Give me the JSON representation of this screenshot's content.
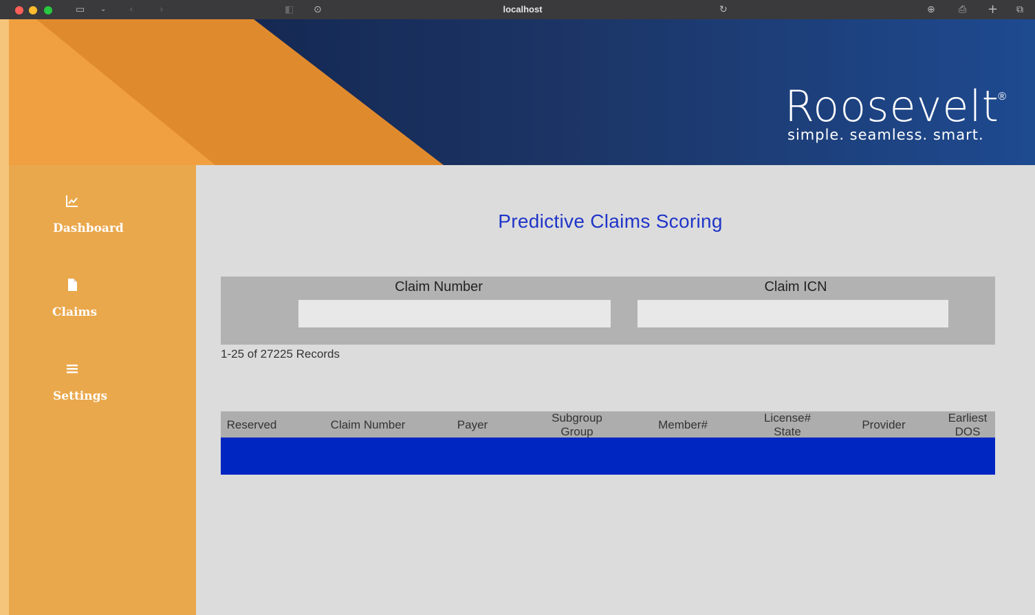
{
  "browser": {
    "url": "localhost"
  },
  "brand": {
    "name": "Roosevelt",
    "registered_mark": "®",
    "tagline": "simple. seamless. smart."
  },
  "sidebar": {
    "items": [
      {
        "label": "Dashboard",
        "icon": "chart-line-icon"
      },
      {
        "label": "Claims",
        "icon": "document-icon"
      },
      {
        "label": "Settings",
        "icon": "menu-icon"
      }
    ]
  },
  "main": {
    "title": "Predictive Claims Scoring",
    "search": {
      "claim_number_label": "Claim Number",
      "claim_number_value": "",
      "claim_icn_label": "Claim ICN",
      "claim_icn_value": ""
    },
    "records_text": "1-25 of 27225 Records",
    "table": {
      "columns": [
        [
          "Reserved"
        ],
        [
          "Claim Number"
        ],
        [
          "Payer"
        ],
        [
          "Subgroup",
          "Group"
        ],
        [
          "Member#"
        ],
        [
          "License#",
          "State"
        ],
        [
          "Provider"
        ],
        [
          "Earliest",
          "DOS"
        ]
      ],
      "selected_row_color": "#0026c2"
    }
  },
  "colors": {
    "sidebar": "#eaa84c",
    "banner_navy": "#1c3566",
    "banner_orange": "#e08a2e",
    "title_blue": "#1f34c8"
  }
}
